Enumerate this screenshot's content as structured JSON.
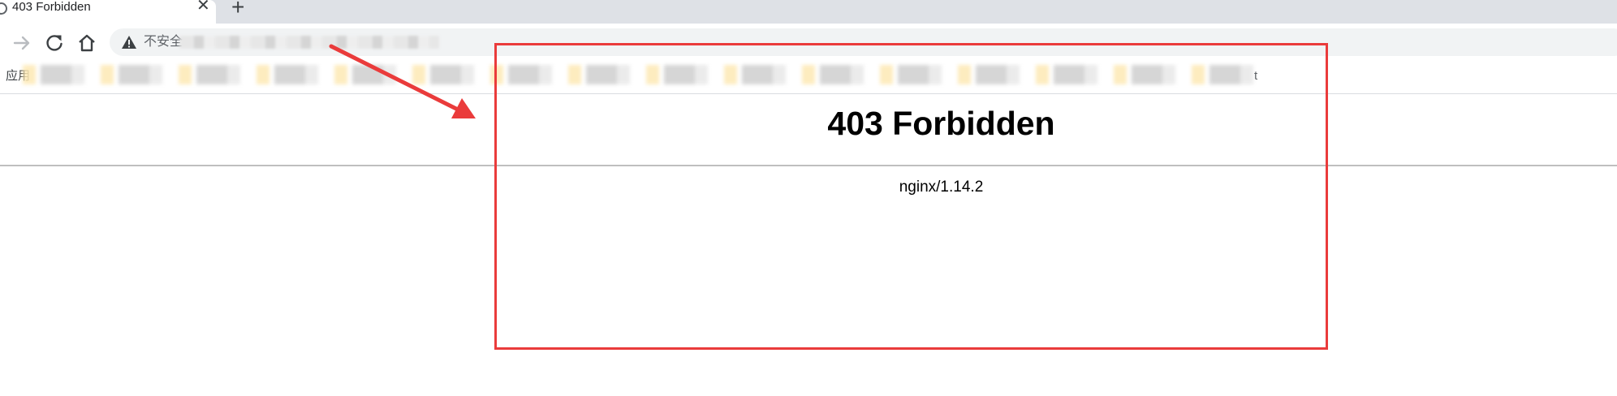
{
  "browser": {
    "tab": {
      "title": "403 Forbidden",
      "close_glyph": "✕",
      "favicon_icon": "globe-icon"
    },
    "new_tab_glyph": "+",
    "nav": {
      "forward_icon": "arrow-right-icon",
      "reload_icon": "reload-icon",
      "home_icon": "home-icon"
    },
    "omnibox": {
      "security_icon": "warning-triangle-icon",
      "security_text": "不安全"
    },
    "bookmarks": {
      "apps_label": "应用",
      "trailing_text": "t"
    }
  },
  "page": {
    "title": "403 Forbidden",
    "server": "nginx/1.14.2"
  },
  "annotation": {
    "highlight_color": "#ea3b3b"
  }
}
